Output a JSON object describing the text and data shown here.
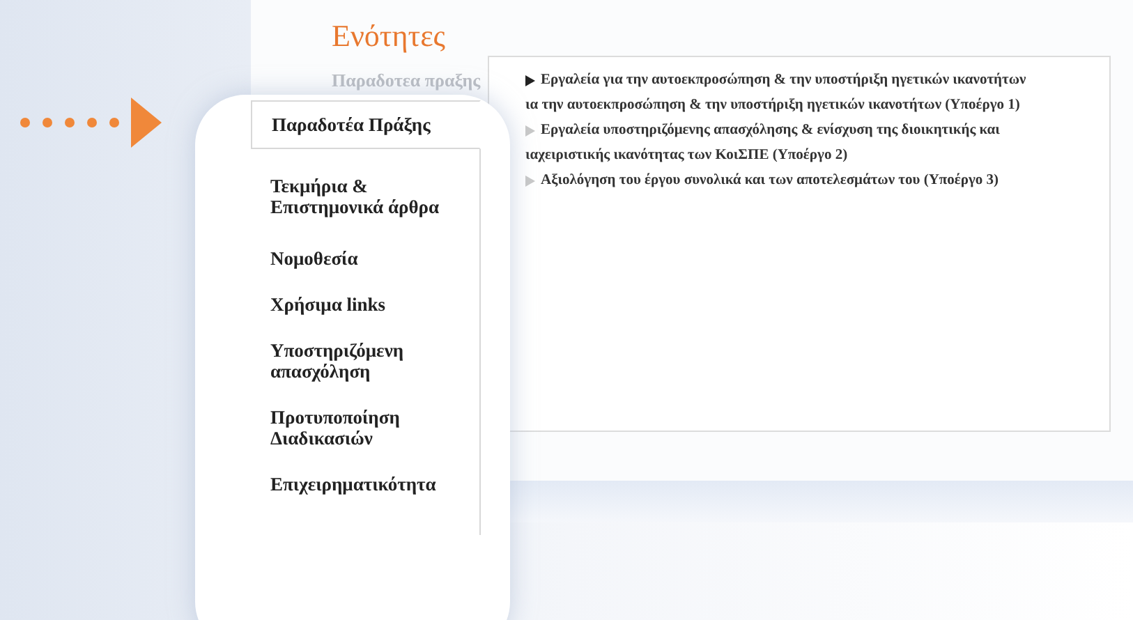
{
  "heading": "Ενότητες",
  "subheading": "Παραδοτεα πραξης",
  "deliverables": [
    {
      "selected": true,
      "lines": [
        "Εργαλεία για την αυτοεκπροσώπηση & την υποστήριξη ηγετικών ικανοτήτων",
        "ια την αυτοεκπροσώπηση & την υποστήριξη ηγετικών ικανοτήτων (Υποέργο 1)"
      ]
    },
    {
      "selected": false,
      "lines": [
        "Εργαλεία υποστηριζόμενης απασχόλησης & ενίσχυση της διοικητικής και",
        "ιαχειριστικής ικανότητας των ΚοιΣΠΕ (Υποέργο 2)"
      ]
    },
    {
      "selected": false,
      "lines": [
        "Αξιολόγηση του έργου συνολικά και των αποτελεσμάτων του (Υποέργο 3)"
      ]
    }
  ],
  "tabs": [
    {
      "label": "Παραδοτέα Πράξης",
      "selected": true
    },
    {
      "label": "Τεκμήρια & Επιστημονικά άρθρα",
      "selected": false
    },
    {
      "label": "Νομοθεσία",
      "selected": false
    },
    {
      "label": "Χρήσιμα links",
      "selected": false
    },
    {
      "label": "Υποστηριζόμενη απασχόληση",
      "selected": false
    },
    {
      "label": "Προτυποποίηση Διαδικασιών",
      "selected": false
    },
    {
      "label": "Επιχειρηματικότητα",
      "selected": false
    }
  ]
}
